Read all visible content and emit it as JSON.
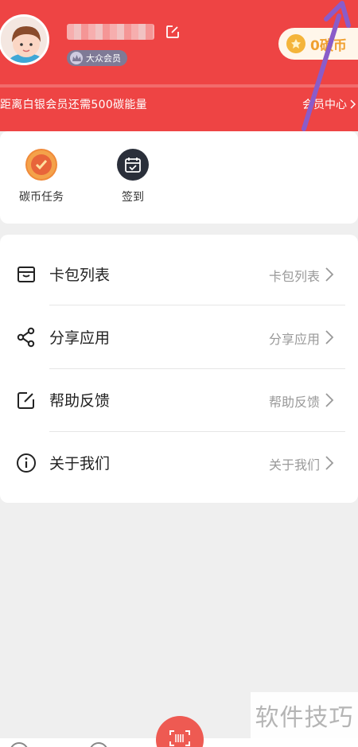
{
  "header": {
    "badge_label": "大众会员",
    "coin_label": "0碳币",
    "progress_text": "距离白银会员还需500碳能量",
    "member_center_label": "会员中心",
    "bg_color": "#ee4444"
  },
  "quick_actions": [
    {
      "label": "碳币任务",
      "icon": "coin-task-icon"
    },
    {
      "label": "签到",
      "icon": "calendar-check-icon"
    }
  ],
  "menu": [
    {
      "title": "卡包列表",
      "value": "卡包列表",
      "icon": "wallet-icon"
    },
    {
      "title": "分享应用",
      "value": "分享应用",
      "icon": "share-icon"
    },
    {
      "title": "帮助反馈",
      "value": "帮助反馈",
      "icon": "feedback-edit-icon"
    },
    {
      "title": "关于我们",
      "value": "关于我们",
      "icon": "info-icon"
    }
  ],
  "watermark": "软件技巧",
  "accent_color": "#ee5a52",
  "annotation_arrow_color": "#8a5cc9"
}
